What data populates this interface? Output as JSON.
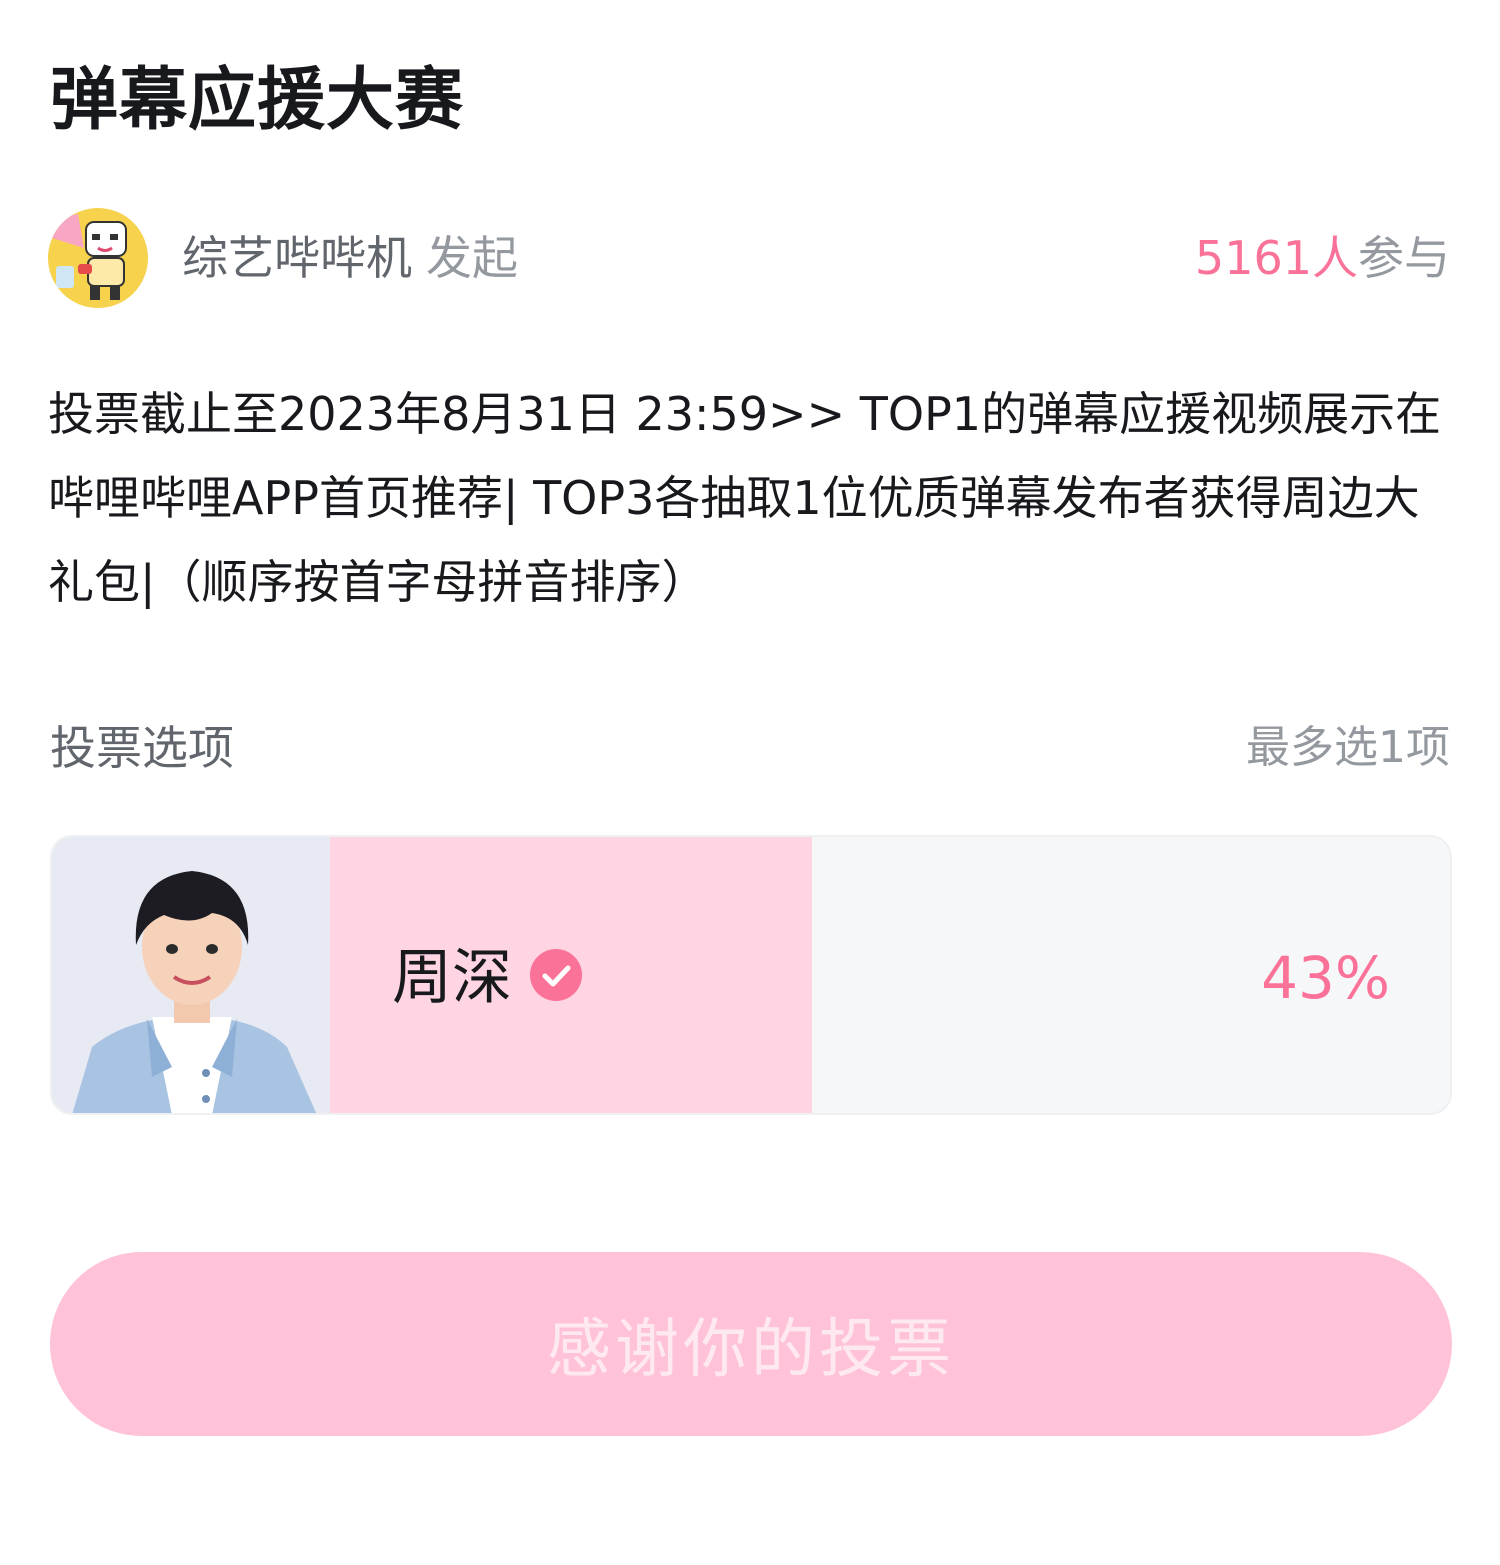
{
  "header": {
    "title": "弹幕应援大赛"
  },
  "author": {
    "name": "综艺哔哔机",
    "suffix": "发起",
    "avatar_icon": "variety-show-mascot-avatar"
  },
  "participants": {
    "count": "5161人",
    "label": "参与"
  },
  "description": "投票截止至2023年8月31日 23:59>> TOP1的弹幕应援视频展示在哔哩哔哩APP首页推荐| TOP3各抽取1位优质弹幕发布者获得周边大礼包|（顺序按首字母拼音排序）",
  "options_section": {
    "title": "投票选项",
    "limit": "最多选1项"
  },
  "options": [
    {
      "name": "周深",
      "percent_label": "43%",
      "share": 0.43,
      "selected": true,
      "photo_icon": "candidate-portrait-photo",
      "check_icon": "check-circle-icon"
    }
  ],
  "vote_button": {
    "label": "感谢你的投票",
    "disabled": true
  },
  "colors": {
    "accent": "#fb7299",
    "option_fill": "#ffd4e3",
    "button_bg": "#ffc2d9"
  }
}
